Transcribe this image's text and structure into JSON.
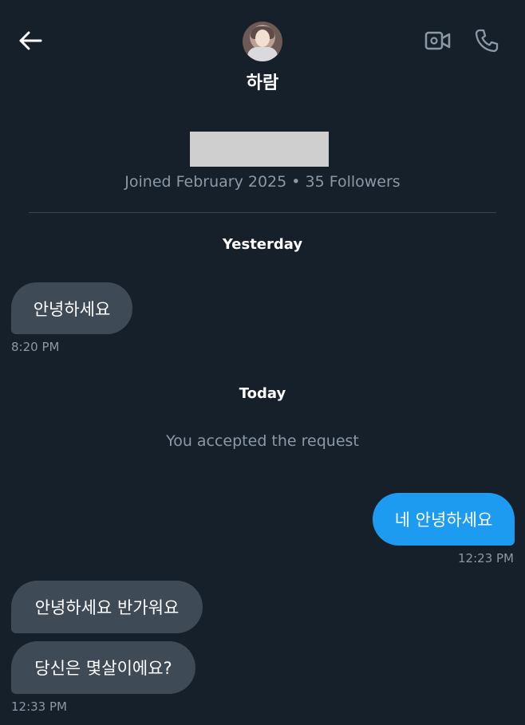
{
  "header": {
    "contact_name": "하람",
    "back_icon": "arrow-left-icon",
    "video_icon": "video-camera-icon",
    "phone_icon": "phone-icon",
    "icon_color": "#ffffff",
    "muted_icon_color": "#8b98a5"
  },
  "profile": {
    "meta": "Joined February 2025 • 35 Followers"
  },
  "conversation": {
    "yesterday_label": "Yesterday",
    "today_label": "Today",
    "system_message": "You accepted the request",
    "messages": [
      {
        "direction": "in",
        "text": "안녕하세요",
        "time": "8:20 PM"
      },
      {
        "direction": "out",
        "text": "네 안녕하세요",
        "time": "12:23 PM"
      },
      {
        "direction": "in",
        "text": "안녕하세요 반가워요",
        "time": ""
      },
      {
        "direction": "in",
        "text": "당신은 몇살이에요?",
        "time": "12:33 PM"
      }
    ]
  },
  "colors": {
    "background": "#15202b",
    "incoming_bubble": "#3e4a55",
    "outgoing_bubble": "#1d9bf0",
    "secondary_text": "#8b98a5",
    "divider": "#38444d"
  }
}
